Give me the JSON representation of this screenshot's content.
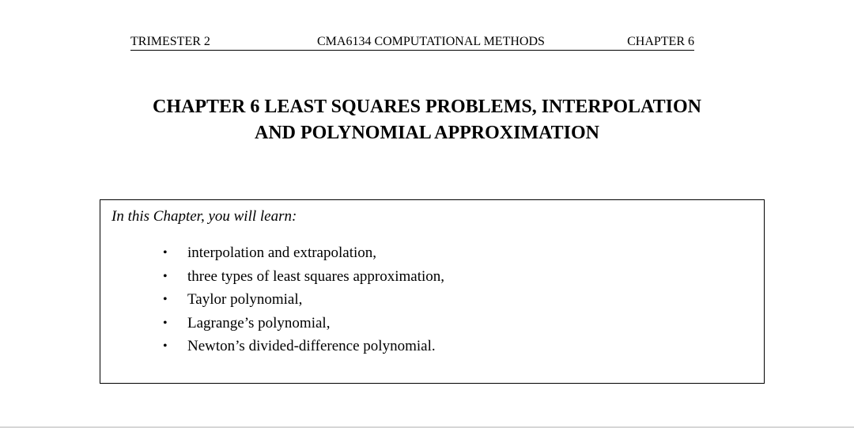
{
  "header": {
    "left": "TRIMESTER 2",
    "center": "CMA6134 COMPUTATIONAL METHODS",
    "right": "CHAPTER 6"
  },
  "title": {
    "line1": "CHAPTER 6 LEAST SQUARES PROBLEMS, INTERPOLATION",
    "line2": "AND POLYNOMIAL APPROXIMATION"
  },
  "objectives": {
    "intro": "In this Chapter, you will learn:",
    "bullet_glyph": "•",
    "items": [
      "interpolation and extrapolation,",
      "three types of least squares approximation,",
      "Taylor polynomial,",
      "Lagrange’s polynomial,",
      "Newton’s divided-difference polynomial."
    ]
  }
}
